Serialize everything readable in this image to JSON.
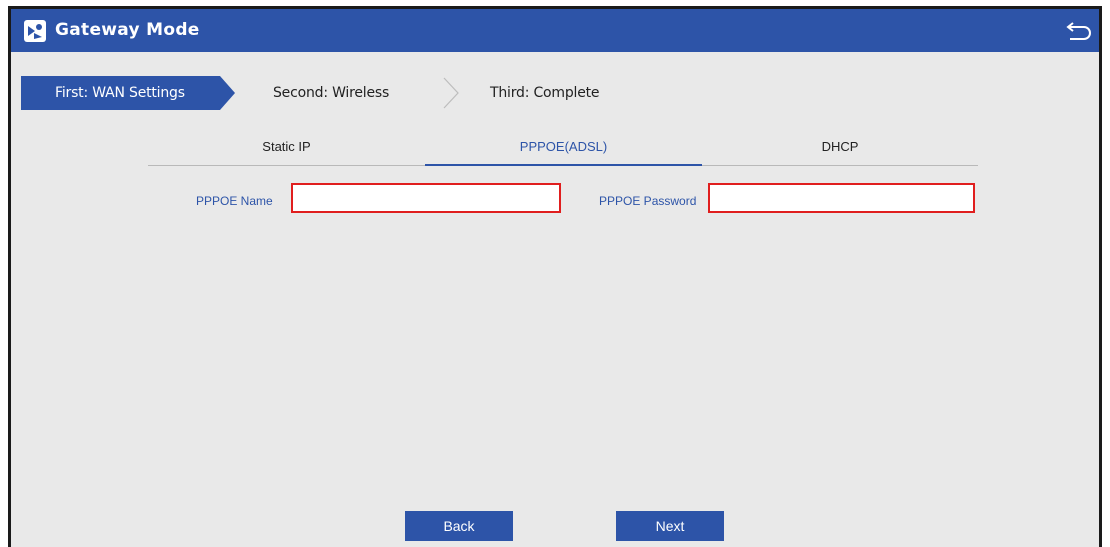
{
  "window": {
    "title": "Gateway Mode",
    "app_icon": "router-icon",
    "back_icon": "return-arrow-icon"
  },
  "steps": [
    {
      "label": "First: WAN Settings",
      "active": true
    },
    {
      "label": "Second: Wireless",
      "active": false
    },
    {
      "label": "Third: Complete",
      "active": false
    }
  ],
  "tabs": [
    {
      "label": "Static IP",
      "active": false
    },
    {
      "label": "PPPOE(ADSL)",
      "active": true
    },
    {
      "label": "DHCP",
      "active": false
    }
  ],
  "form": {
    "pppoe_name_label": "PPPOE Name",
    "pppoe_name_value": "",
    "pppoe_password_label": "PPPOE Password",
    "pppoe_password_value": ""
  },
  "buttons": {
    "back": "Back",
    "next": "Next"
  },
  "colors": {
    "accent": "#2d54a8",
    "background": "#e9e9e9",
    "input_border": "#e01e1e"
  }
}
